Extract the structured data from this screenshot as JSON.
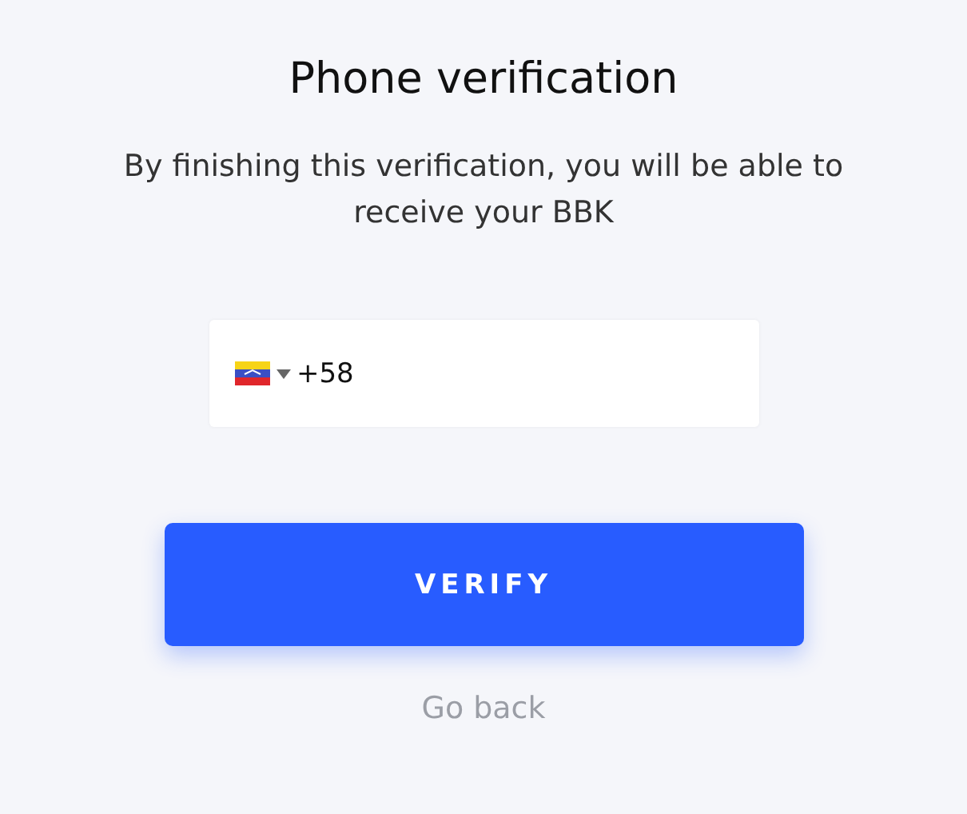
{
  "title": "Phone verification",
  "subtitle": "By finishing this verification, you will be able to receive your BBK",
  "phone_field": {
    "value": "+58"
  },
  "verify_button": "VERIFY",
  "back_link": "Go back"
}
